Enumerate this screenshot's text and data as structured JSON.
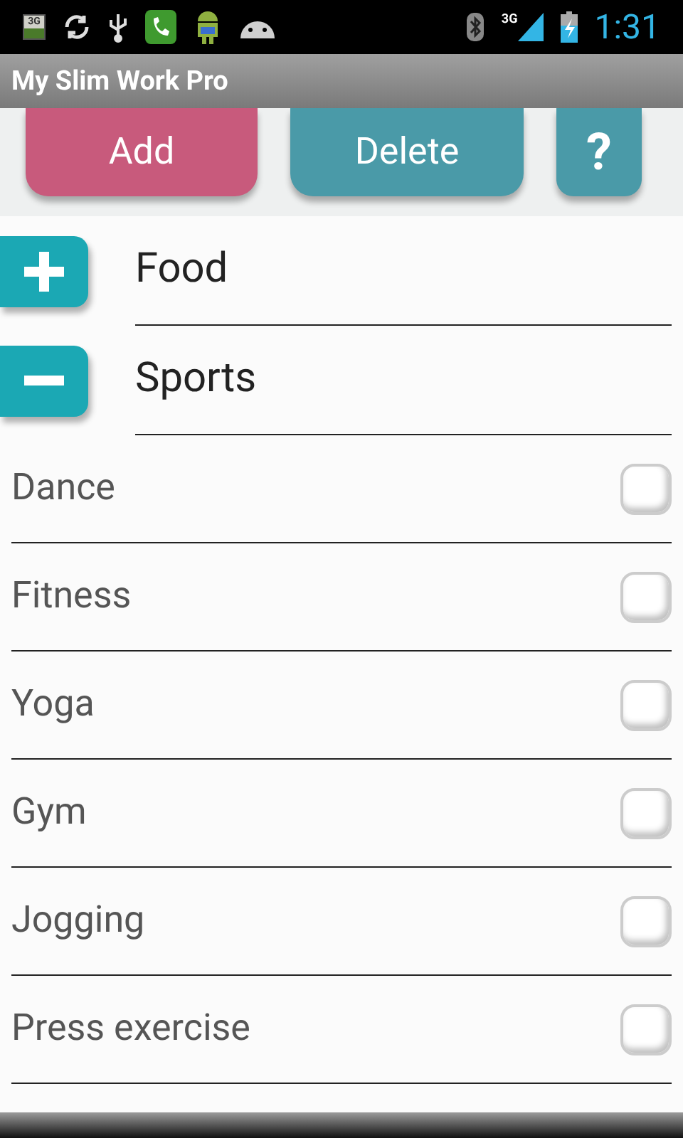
{
  "status_bar": {
    "sim_label": "3G",
    "network": "3G",
    "time": "1:31"
  },
  "title_bar": {
    "title": "My Slim Work Pro"
  },
  "toolbar": {
    "add": "Add",
    "delete": "Delete",
    "help": "?"
  },
  "categories": [
    {
      "label": "Food",
      "expanded": false
    },
    {
      "label": "Sports",
      "expanded": true,
      "items": [
        {
          "label": "Dance",
          "checked": false
        },
        {
          "label": "Fitness",
          "checked": false
        },
        {
          "label": "Yoga",
          "checked": false
        },
        {
          "label": "Gym",
          "checked": false
        },
        {
          "label": "Jogging",
          "checked": false
        },
        {
          "label": "Press exercise",
          "checked": false
        }
      ]
    }
  ]
}
